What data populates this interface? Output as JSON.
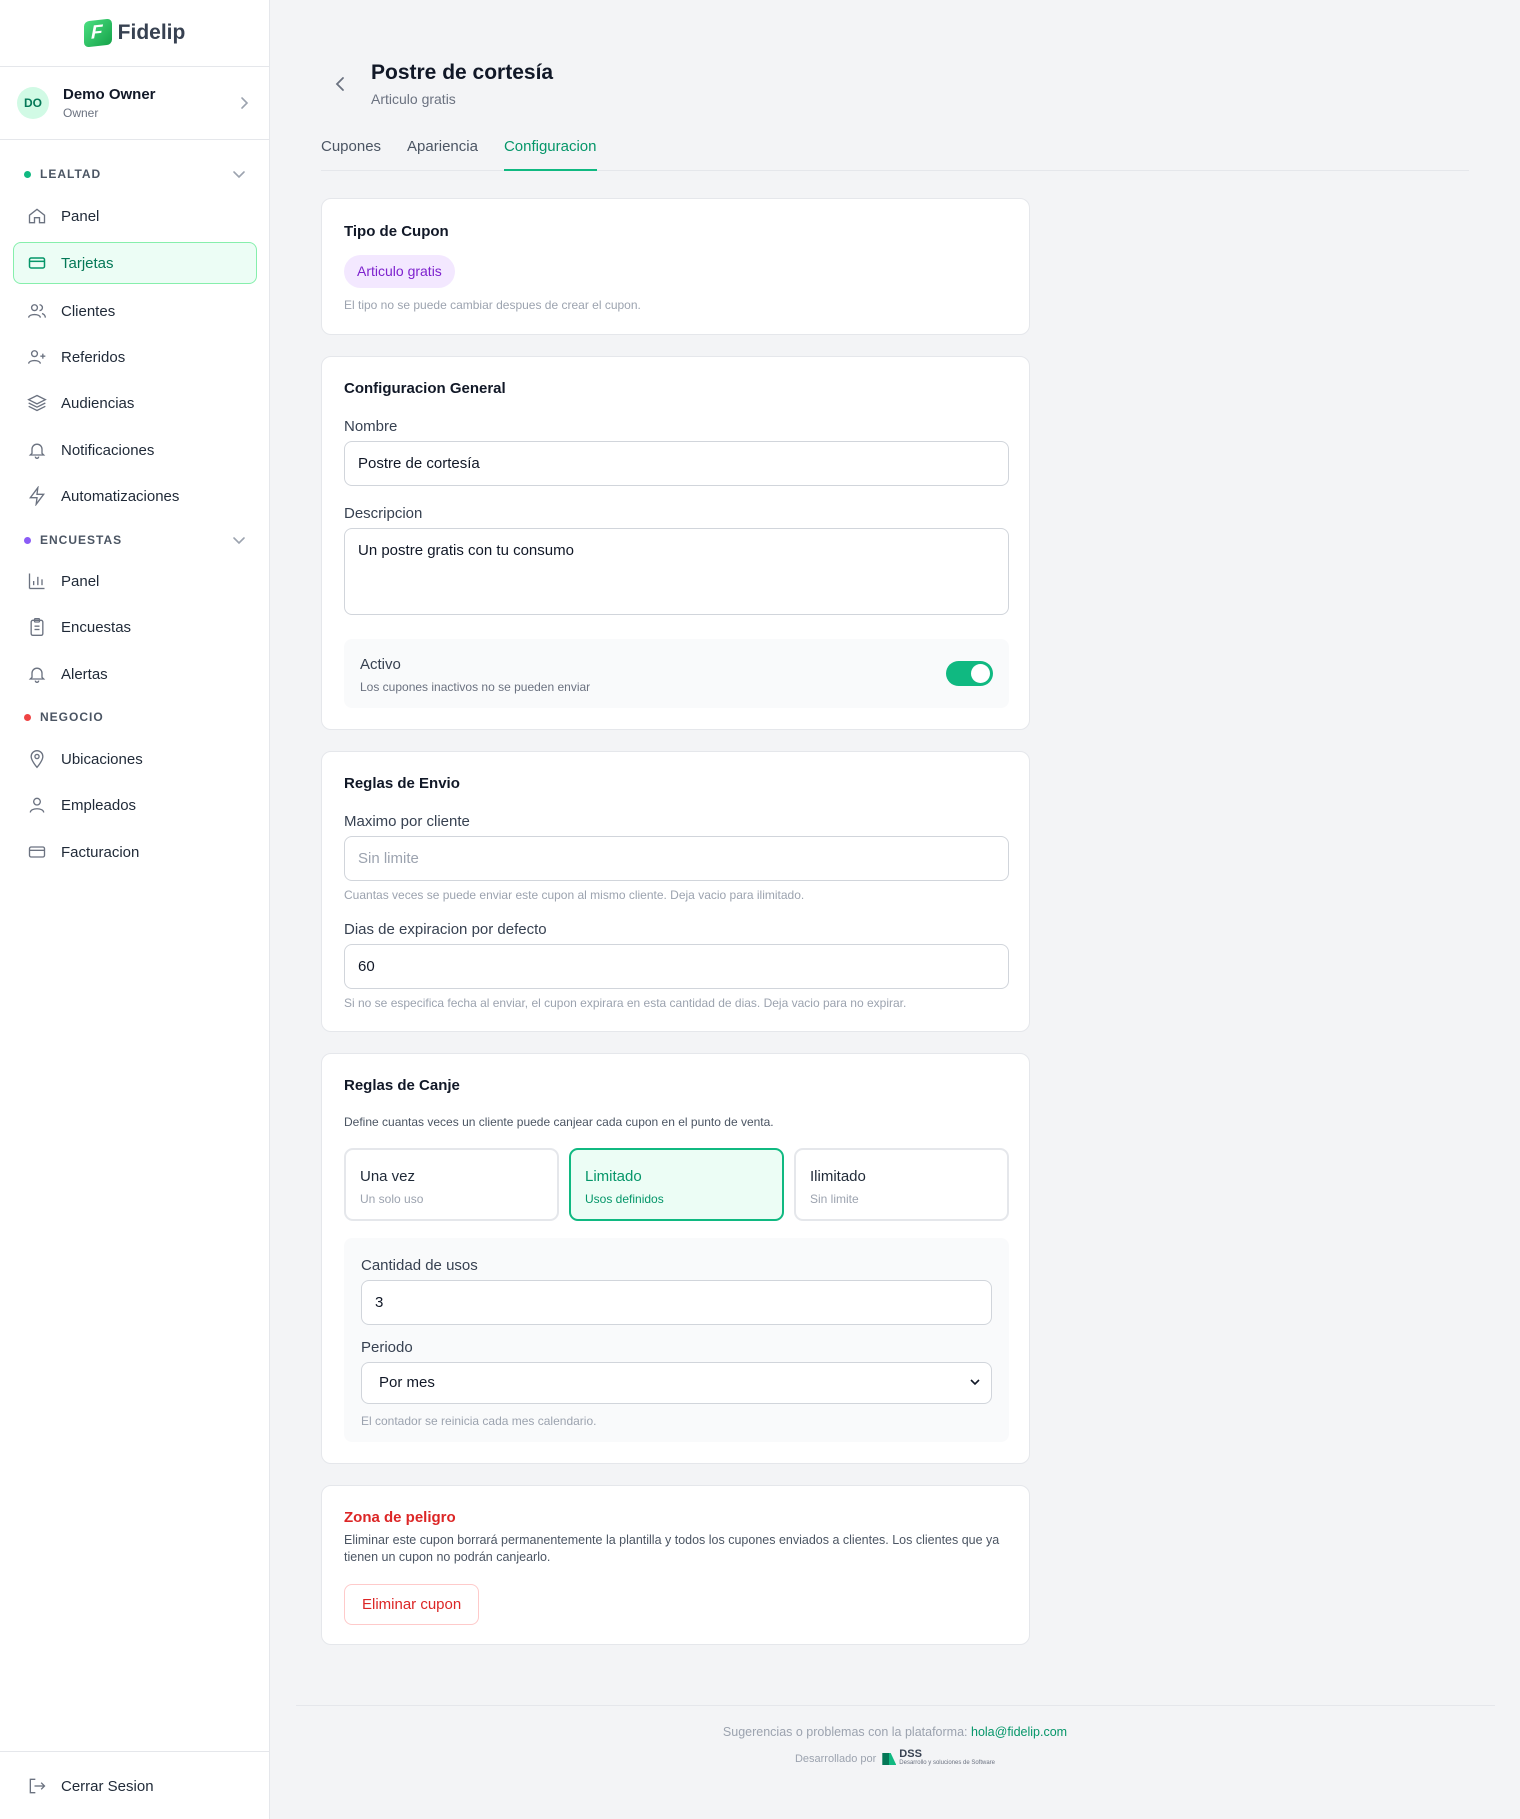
{
  "app": {
    "name": "Fidelip",
    "logo_letter": "F"
  },
  "user": {
    "initials": "DO",
    "name": "Demo Owner",
    "role": "Owner"
  },
  "sidebar": {
    "sections": [
      {
        "label": "LEALTAD",
        "color": "#10b981"
      },
      {
        "label": "ENCUESTAS",
        "color": "#8b5cf6"
      },
      {
        "label": "NEGOCIO",
        "color": "#ef4444"
      }
    ],
    "items": [
      {
        "label": "Panel",
        "icon": "home-icon"
      },
      {
        "label": "Tarjetas",
        "icon": "card-icon",
        "active": true
      },
      {
        "label": "Clientes",
        "icon": "users-icon"
      },
      {
        "label": "Referidos",
        "icon": "user-plus-icon"
      },
      {
        "label": "Audiencias",
        "icon": "layers-icon"
      },
      {
        "label": "Notificaciones",
        "icon": "bell-icon"
      },
      {
        "label": "Automatizaciones",
        "icon": "bolt-icon"
      },
      {
        "label": "Panel",
        "icon": "bar-chart-icon"
      },
      {
        "label": "Encuestas",
        "icon": "clipboard-icon"
      },
      {
        "label": "Alertas",
        "icon": "bell-icon"
      },
      {
        "label": "Ubicaciones",
        "icon": "map-pin-icon"
      },
      {
        "label": "Empleados",
        "icon": "user-icon"
      },
      {
        "label": "Facturacion",
        "icon": "card-icon"
      }
    ],
    "logout": "Cerrar Sesion"
  },
  "header": {
    "title": "Postre de cortesía",
    "subtitle": "Articulo gratis"
  },
  "tabs": [
    {
      "label": "Cupones"
    },
    {
      "label": "Apariencia"
    },
    {
      "label": "Configuracion",
      "active": true
    }
  ],
  "tipo": {
    "title": "Tipo de Cupon",
    "value": "Articulo gratis",
    "help": "El tipo no se puede cambiar despues de crear el cupon."
  },
  "general": {
    "title": "Configuracion General",
    "nombre_label": "Nombre",
    "nombre_value": "Postre de cortesía",
    "descripcion_label": "Descripcion",
    "descripcion_value": "Un postre gratis con tu consumo",
    "activo_label": "Activo",
    "activo_help": "Los cupones inactivos no se pueden enviar",
    "activo_on": true
  },
  "envio": {
    "title": "Reglas de Envio",
    "max_label": "Maximo por cliente",
    "max_placeholder": "Sin limite",
    "max_help": "Cuantas veces se puede enviar este cupon al mismo cliente. Deja vacio para ilimitado.",
    "dias_label": "Dias de expiracion por defecto",
    "dias_value": "60",
    "dias_help": "Si no se especifica fecha al enviar, el cupon expirara en esta cantidad de dias. Deja vacio para no expirar."
  },
  "canje": {
    "title": "Reglas de Canje",
    "desc": "Define cuantas veces un cliente puede canjear cada cupon en el punto de venta.",
    "options": [
      {
        "title": "Una vez",
        "sub": "Un solo uso"
      },
      {
        "title": "Limitado",
        "sub": "Usos definidos",
        "selected": true
      },
      {
        "title": "Ilimitado",
        "sub": "Sin limite"
      }
    ],
    "cantidad_label": "Cantidad de usos",
    "cantidad_value": "3",
    "periodo_label": "Periodo",
    "periodo_value": "Por mes",
    "periodo_help": "El contador se reinicia cada mes calendario."
  },
  "danger": {
    "title": "Zona de peligro",
    "text": "Eliminar este cupon borrará permanentemente la plantilla y todos los cupones enviados a clientes. Los clientes que ya tienen un cupon no podrán canjearlo.",
    "button": "Eliminar cupon"
  },
  "footer": {
    "text": "Sugerencias o problemas con la plataforma:",
    "email": "hola@fidelip.com",
    "dev": "Desarrollado por",
    "dev_brand": "DSS",
    "dev_brand_sub": "Desarrollo y soluciones de Software"
  },
  "colors": {
    "accent": "#10b981",
    "danger": "#dc2626",
    "purple_pill": "#7e22ce"
  }
}
